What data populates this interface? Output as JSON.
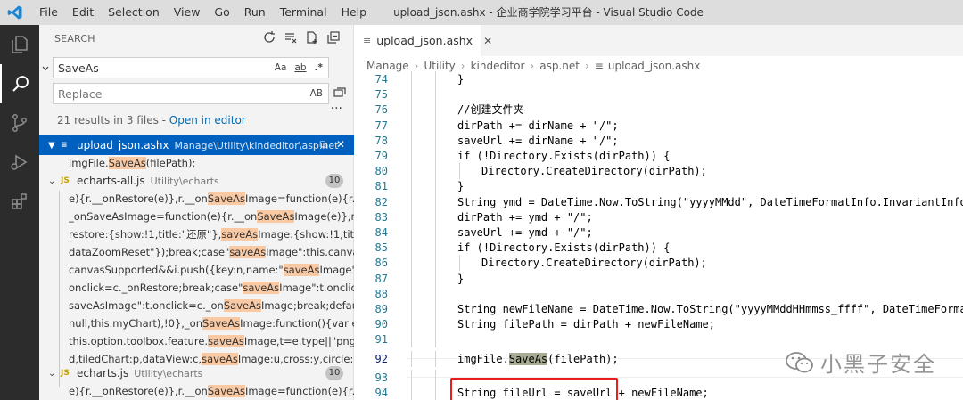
{
  "titlebar": {
    "menu": [
      "File",
      "Edit",
      "Selection",
      "View",
      "Go",
      "Run",
      "Terminal",
      "Help"
    ],
    "window_title": "upload_json.ashx - 企业商学院学习平台 - Visual Studio Code"
  },
  "sidebar": {
    "header": "SEARCH",
    "search_value": "SaveAs",
    "search_opts": [
      "Aa",
      "ab",
      ".*"
    ],
    "replace_placeholder": "Replace",
    "replace_opt": "AB",
    "summary_text": "21 results in 3 files - ",
    "summary_link": "Open in editor",
    "files": [
      {
        "name": "upload_json.ashx",
        "path": "Manage\\Utility\\kindeditor\\asp.net",
        "icon": "≡",
        "selected": true
      },
      {
        "name": "echarts-all.js",
        "path": "Utility\\echarts",
        "icon": "JS",
        "count": "10"
      },
      {
        "name": "echarts.js",
        "path": "Utility\\echarts",
        "icon": "JS",
        "count": "10"
      }
    ],
    "matches_file1": [
      {
        "pre": "imgFile.",
        "hl": "SaveAs",
        "post": "(filePath);"
      }
    ],
    "matches_file2": [
      {
        "pre": "e){r.__onRestore(e)},r.__on",
        "hl": "SaveAs",
        "post": "Image=function(e){r.__onSav..."
      },
      {
        "pre": "_onSaveAsImage=function(e){r.__on",
        "hl": "SaveAs",
        "post": "Image(e)},r.__onM..."
      },
      {
        "pre": "restore:{show:!1,title:\"还原\"},",
        "hl": "saveAs",
        "post": "Image:{show:!1,title:\"保存..."
      },
      {
        "pre": "dataZoomReset\"});break;case\"",
        "hl": "saveAs",
        "post": "Image\":this.canvasSupp..."
      },
      {
        "pre": "canvasSupported&&i.push({key:n,name:\"",
        "hl": "saveAs",
        "post": "Image\"});bre..."
      },
      {
        "pre": "onclick=c._onRestore;break;case\"",
        "hl": "saveAs",
        "post": "Image\":t.onclick=c._..."
      },
      {
        "pre": "saveAsImage\":t.onclick=c._on",
        "hl": "SaveAs",
        "post": "Image;break;default:this..."
      },
      {
        "pre": "null,this.myChart),!0},_on",
        "hl": "SaveAs",
        "post": "Image:function(){var e=this...."
      },
      {
        "pre": "this.option.toolbox.feature.",
        "hl": "saveAs",
        "post": "Image,t=e.type||\"png\";\"pn..."
      },
      {
        "pre": "d,tiledChart:p,dataView:c,",
        "hl": "saveAs",
        "post": "Image:u,cross:y,circle:g,recta..."
      }
    ],
    "matches_file3": [
      {
        "pre": "e){r.__onRestore(e)},r.__on",
        "hl": "SaveAs",
        "post": "Image=function(e){r.__on..."
      }
    ]
  },
  "editor": {
    "tab_label": "upload_json.ashx",
    "tab_icon": "≡",
    "breadcrumb": [
      "Manage",
      "Utility",
      "kindeditor",
      "asp.net",
      "upload_json.ashx"
    ],
    "lines": [
      {
        "n": "74",
        "indent": 1,
        "text": "}"
      },
      {
        "n": "75",
        "indent": 0,
        "text": ""
      },
      {
        "n": "76",
        "indent": 1,
        "text": "//创建文件夹"
      },
      {
        "n": "77",
        "indent": 1,
        "text": "dirPath += dirName + \"/\";"
      },
      {
        "n": "78",
        "indent": 1,
        "text": "saveUrl += dirName + \"/\";"
      },
      {
        "n": "79",
        "indent": 1,
        "text": "if (!Directory.Exists(dirPath)) {"
      },
      {
        "n": "80",
        "indent": 2,
        "text": "Directory.CreateDirectory(dirPath);"
      },
      {
        "n": "81",
        "indent": 1,
        "text": "}"
      },
      {
        "n": "82",
        "indent": 1,
        "text": "String ymd = DateTime.Now.ToString(\"yyyyMMdd\", DateTimeFormatInfo.InvariantInfo);"
      },
      {
        "n": "83",
        "indent": 1,
        "text": "dirPath += ymd + \"/\";"
      },
      {
        "n": "84",
        "indent": 1,
        "text": "saveUrl += ymd + \"/\";"
      },
      {
        "n": "85",
        "indent": 1,
        "text": "if (!Directory.Exists(dirPath)) {"
      },
      {
        "n": "86",
        "indent": 2,
        "text": "Directory.CreateDirectory(dirPath);"
      },
      {
        "n": "87",
        "indent": 1,
        "text": "}"
      },
      {
        "n": "88",
        "indent": 0,
        "text": ""
      },
      {
        "n": "89",
        "indent": 1,
        "text": "String newFileName = DateTime.Now.ToString(\"yyyyMMddHHmmss_ffff\", DateTimeFormatIn"
      },
      {
        "n": "90",
        "indent": 1,
        "text": "String filePath = dirPath + newFileName;"
      },
      {
        "n": "91",
        "indent": 0,
        "text": ""
      },
      {
        "n": "92",
        "indent": 1,
        "text": "",
        "pre": "imgFile.",
        "hl": "SaveAs",
        "post": "(filePath);",
        "current": true
      },
      {
        "n": "93",
        "indent": 0,
        "text": ""
      },
      {
        "n": "94",
        "indent": 1,
        "text": "String fileUrl = saveUrl + newFileName;"
      }
    ]
  },
  "watermark": {
    "text": "小黑子安全"
  },
  "colors": {
    "accent": "#0060c0",
    "highlight": "#f9c9a4",
    "annotation_box": "#e81e1e"
  }
}
